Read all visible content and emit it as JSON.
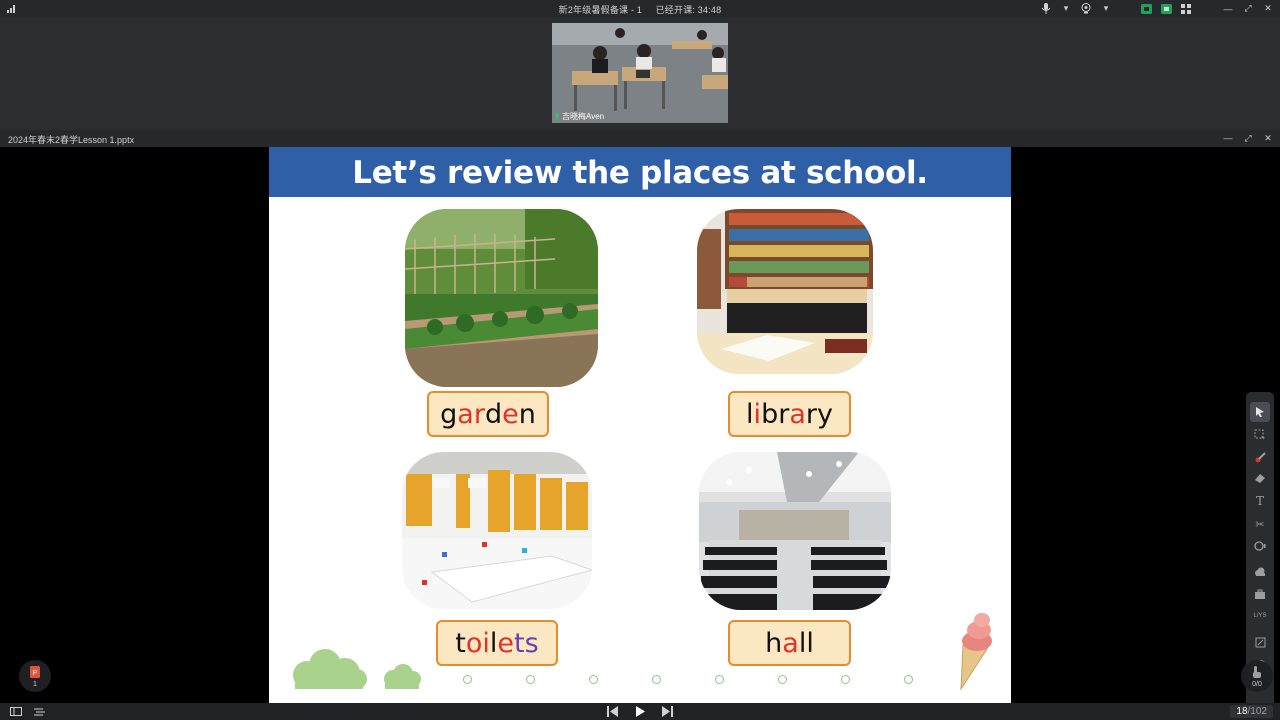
{
  "window": {
    "title": "新2年级暑假备课 - 1",
    "class_timer_label": "已经开课: 34:48"
  },
  "video": {
    "participant_name": "吉晓梅Aven"
  },
  "document": {
    "filename": "2024年春末2春学Lesson 1.pptx"
  },
  "slide": {
    "title": "Let’s review the places at school.",
    "words": [
      {
        "id": "garden",
        "letters": [
          {
            "t": "g",
            "c": "#111111"
          },
          {
            "t": "ar",
            "c": "#e0322b"
          },
          {
            "t": "d",
            "c": "#111111"
          },
          {
            "t": "e",
            "c": "#e0322b"
          },
          {
            "t": "n",
            "c": "#111111"
          }
        ]
      },
      {
        "id": "library",
        "letters": [
          {
            "t": "l",
            "c": "#111111"
          },
          {
            "t": "i",
            "c": "#e0322b"
          },
          {
            "t": "br",
            "c": "#111111"
          },
          {
            "t": "a",
            "c": "#e0322b"
          },
          {
            "t": "ry",
            "c": "#111111"
          }
        ]
      },
      {
        "id": "toilets",
        "letters": [
          {
            "t": "t",
            "c": "#111111"
          },
          {
            "t": "oi",
            "c": "#e0322b"
          },
          {
            "t": "l",
            "c": "#111111"
          },
          {
            "t": "e",
            "c": "#e0322b"
          },
          {
            "t": "ts",
            "c": "#6a3fb5"
          }
        ]
      },
      {
        "id": "hall",
        "letters": [
          {
            "t": "h",
            "c": "#111111"
          },
          {
            "t": "a",
            "c": "#e0322b"
          },
          {
            "t": "ll",
            "c": "#111111"
          }
        ]
      }
    ]
  },
  "toolbar": {
    "tools": [
      "pointer-icon",
      "select-icon",
      "laser-icon",
      "eraser-icon",
      "text-icon",
      "scissors-icon",
      "shape-icon",
      "cloud-icon",
      "toolbox-icon",
      "count-icon",
      "note-icon",
      "chat-icon",
      "users-icon"
    ],
    "count_label": "L/YS"
  },
  "slides_thumb": {
    "count": "1"
  },
  "stats": {
    "value": "0/0"
  },
  "pagination": {
    "current": "18",
    "total": "/102"
  },
  "colors": {
    "header_blue": "#2f5fa7",
    "label_bg": "#fce7c3",
    "label_border": "#e98a2c",
    "accent_red": "#e0322b"
  }
}
